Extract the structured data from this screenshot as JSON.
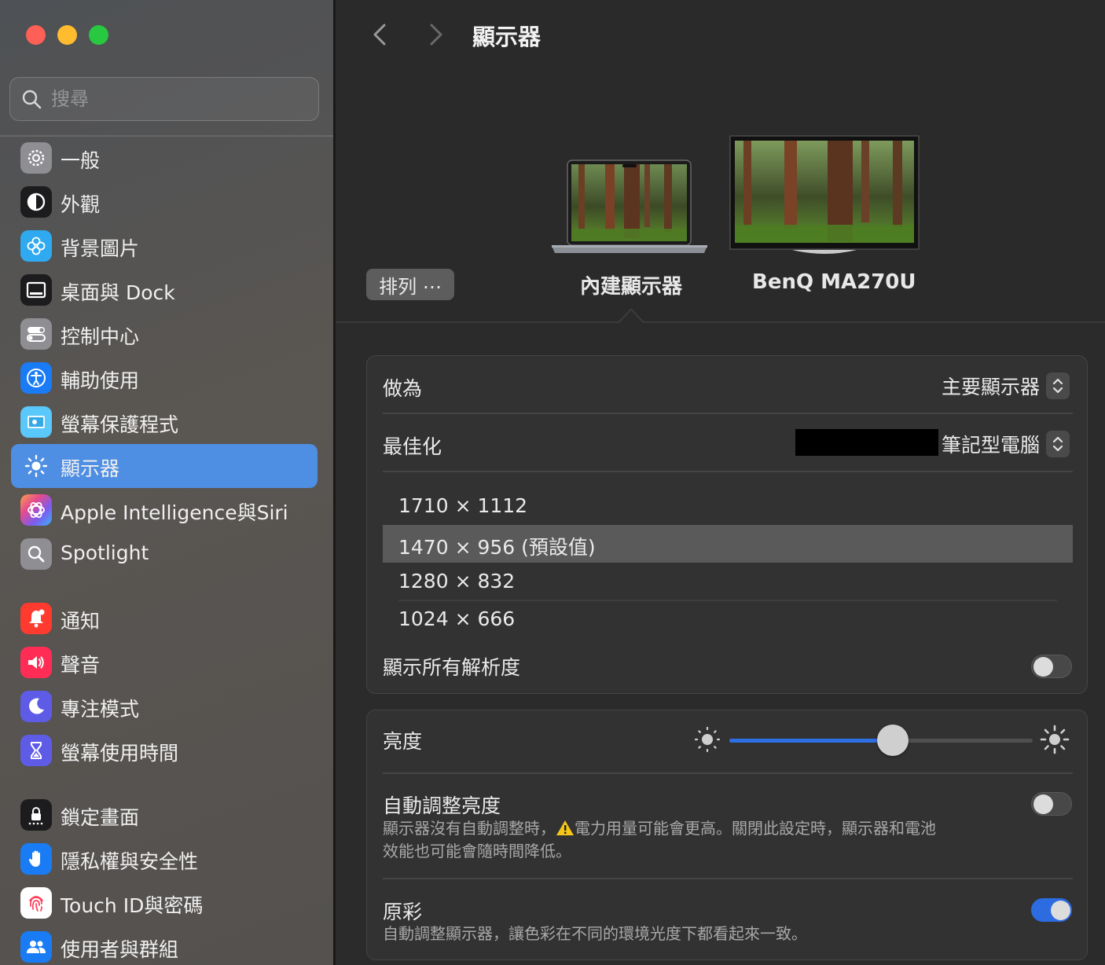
{
  "sidebar": {
    "search_placeholder": "搜尋",
    "groups": [
      [
        {
          "label": "一般",
          "icon": "gear-icon"
        },
        {
          "label": "外觀",
          "icon": "appearance-icon"
        },
        {
          "label": "背景圖片",
          "icon": "wallpaper-icon"
        },
        {
          "label": "桌面與 Dock",
          "icon": "dock-icon"
        },
        {
          "label": "控制中心",
          "icon": "control-center-icon"
        },
        {
          "label": "輔助使用",
          "icon": "accessibility-icon"
        },
        {
          "label": "螢幕保護程式",
          "icon": "screensaver-icon"
        },
        {
          "label": "顯示器",
          "icon": "displays-icon",
          "active": true
        },
        {
          "label": "Apple Intelligence與Siri",
          "icon": "siri-icon"
        },
        {
          "label": "Spotlight",
          "icon": "spotlight-icon"
        }
      ],
      [
        {
          "label": "通知",
          "icon": "bell-icon"
        },
        {
          "label": "聲音",
          "icon": "speaker-icon"
        },
        {
          "label": "專注模式",
          "icon": "moon-icon"
        },
        {
          "label": "螢幕使用時間",
          "icon": "hourglass-icon"
        }
      ],
      [
        {
          "label": "鎖定畫面",
          "icon": "lock-icon"
        },
        {
          "label": "隱私權與安全性",
          "icon": "hand-icon"
        },
        {
          "label": "Touch ID與密碼",
          "icon": "fingerprint-icon"
        },
        {
          "label": "使用者與群組",
          "icon": "users-icon"
        }
      ]
    ]
  },
  "header": {
    "title": "顯示器"
  },
  "displays": {
    "arrange_label": "排列 ⋯",
    "builtin_label": "內建顯示器",
    "external_label": "BenQ MA270U"
  },
  "panel1": {
    "use_as_label": "做為",
    "use_as_value": "主要顯示器",
    "optimize_label": "最佳化",
    "optimize_value": "筆記型電腦",
    "resolutions": [
      "1710 × 1112",
      "1470 × 956 (預設值)",
      "1280 × 832",
      "1024 × 666"
    ],
    "selected_resolution_index": 1,
    "show_all_label": "顯示所有解析度",
    "show_all_on": false
  },
  "panel2": {
    "brightness_label": "亮度",
    "brightness_level": 0.54,
    "auto_brightness_label": "自動調整亮度",
    "auto_brightness_desc_1": "顯示器沒有自動調整時，",
    "auto_brightness_warning": "電力用量可能會更高。關閉此設定時，顯示器和電池",
    "auto_brightness_desc_2": "效能也可能會隨時間降低。",
    "auto_brightness_on": false,
    "true_tone_label": "原彩",
    "true_tone_desc": "自動調整顯示器，讓色彩在不同的環境光度下都看起來一致。",
    "true_tone_on": true
  },
  "colors": {
    "accent": "#2d6be0",
    "sidebar_active": "#4e8ee3",
    "warning": "#f5c518"
  }
}
